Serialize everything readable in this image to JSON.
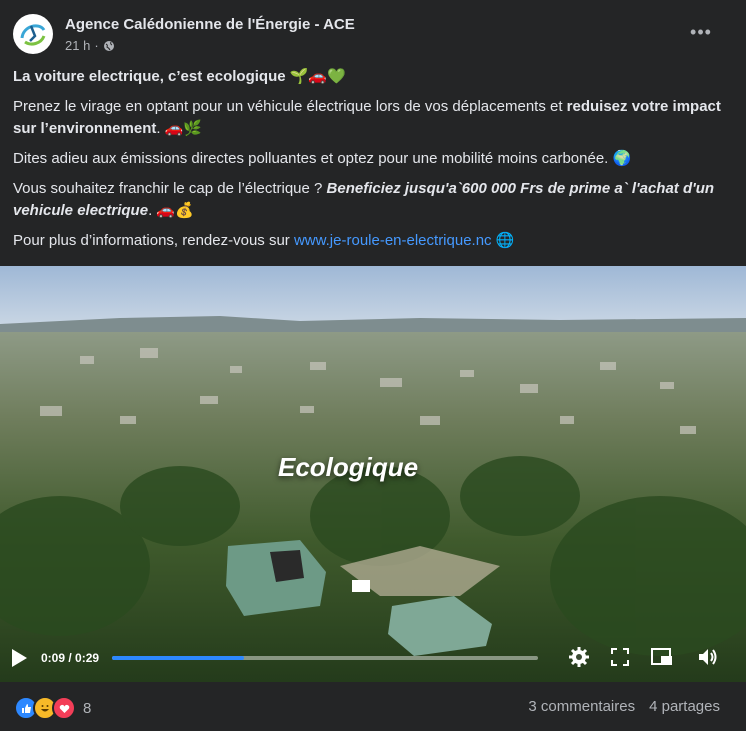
{
  "post": {
    "author": "Agence Calédonienne de l'Énergie - ACE",
    "time": "21 h",
    "more_label": "•••"
  },
  "text": {
    "line1": "La voiture electrique, c’est ecologique 🌱🚗💚",
    "p2_a": "Prenez le virage en optant pour un véhicule électrique lors de vos déplacements et ",
    "p2_b": "reduisez votre impact sur l’environnement",
    "p2_c": ". 🚗🌿",
    "p3": "Dites adieu aux émissions directes polluantes et optez pour une mobilité moins carbonée. 🌍",
    "p4_a": "Vous souhaitez franchir le cap de l’électrique ? ",
    "p4_b": "Beneficiez jusqu'a`600 000 Frs de prime a` l'achat d'un vehicule electrique",
    "p4_c": ". 🚗💰",
    "p5_a": "Pour plus d’informations, rendez-vous sur ",
    "p5_link": "www.je-roule-en-electrique.nc",
    "p5_c": " 🌐"
  },
  "video": {
    "overlay": "Ecologique",
    "time": "0:09 / 0:29",
    "progress": 0.31
  },
  "footer": {
    "reaction_count": "8",
    "comments": "3 commentaires",
    "shares": "4 partages"
  },
  "colors": {
    "link": "#4599ff",
    "progress": "#2d88ff",
    "like": "#2d88ff",
    "love": "#f33e58",
    "haha": "#f7b928"
  }
}
